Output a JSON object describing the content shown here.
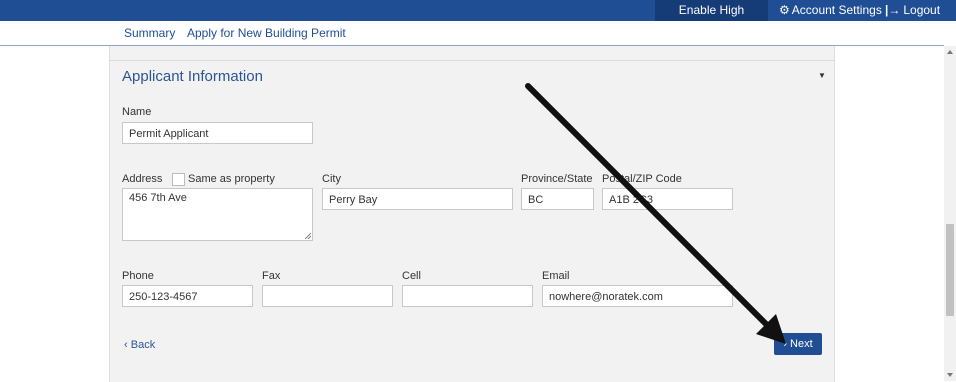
{
  "topbar": {
    "high_contrast": "Enable High Contrast",
    "account_settings": "Account Settings",
    "logout": "Logout"
  },
  "subnav": {
    "summary": "Summary",
    "apply": "Apply for New Building Permit"
  },
  "section": {
    "title": "Applicant Information"
  },
  "form": {
    "name_label": "Name",
    "name_value": "Permit Applicant",
    "address_label": "Address",
    "same_as_property_label": "Same as property",
    "address_value": "456 7th Ave",
    "city_label": "City",
    "city_value": "Perry Bay",
    "province_label": "Province/State",
    "province_value": "BC",
    "postal_label": "Postal/ZIP Code",
    "postal_value": "A1B 2C3",
    "phone_label": "Phone",
    "phone_value": "250-123-4567",
    "fax_label": "Fax",
    "fax_value": "",
    "cell_label": "Cell",
    "cell_value": "",
    "email_label": "Email",
    "email_value": "nowhere@noratek.com"
  },
  "buttons": {
    "back": "Back",
    "next": "Next"
  },
  "icons": {
    "gear": "gear-icon",
    "logout": "logout-icon",
    "caret": "caret-down-icon",
    "back": "chevron-left-icon",
    "next": "chevron-right-icon"
  },
  "colors": {
    "brand": "#1f4e95",
    "accent_text": "#2c5596"
  }
}
